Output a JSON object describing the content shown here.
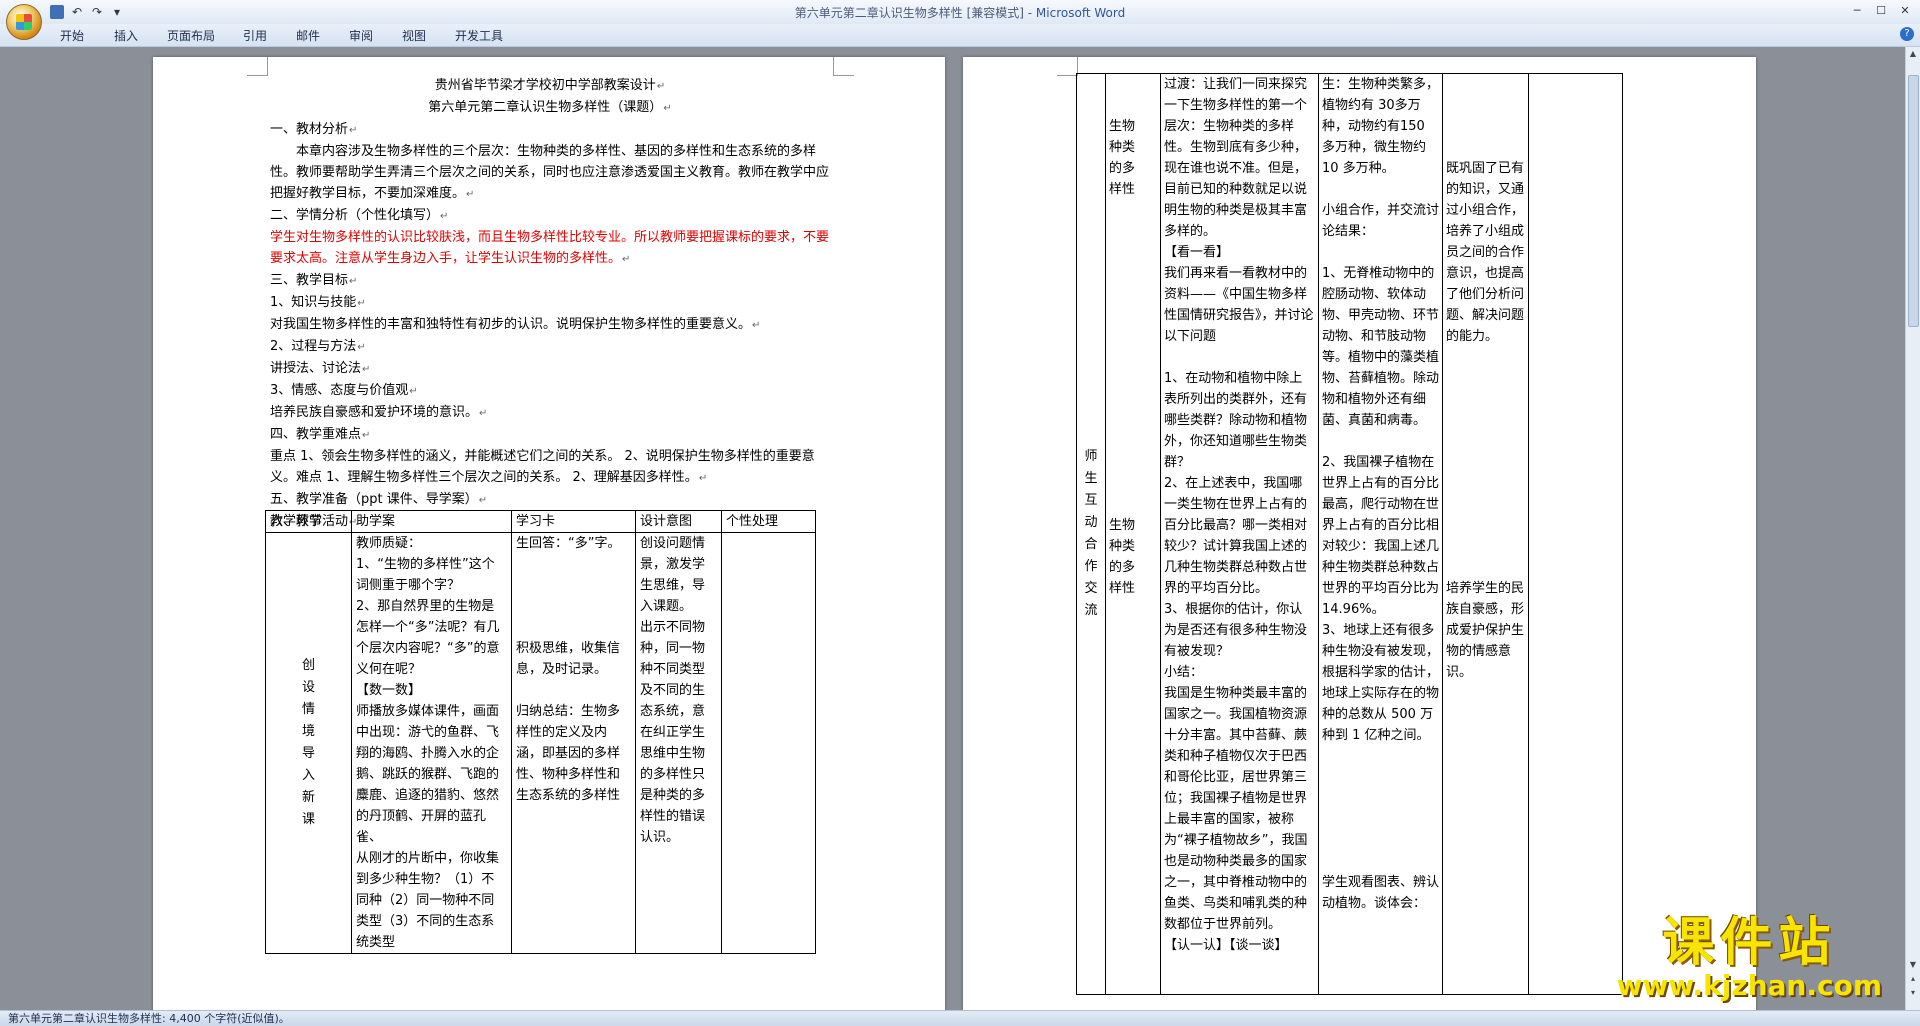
{
  "window": {
    "title": "第六单元第二章认识生物多样性 [兼容模式] - ",
    "app": "Microsoft Word"
  },
  "ribbon": {
    "tabs": [
      "开始",
      "插入",
      "页面布局",
      "引用",
      "邮件",
      "审阅",
      "视图",
      "开发工具"
    ]
  },
  "page1": {
    "title1": "贵州省毕节梁才学校初中学部教案设计",
    "title2": "第六单元第二章认识生物多样性（课题）",
    "lines": [
      {
        "text": "一、教材分析",
        "cls": ""
      },
      {
        "text": "本章内容涉及生物多样性的三个层次：生物种类的多样性、基因的多样性和生态系统的多样性。教师要帮助学生弄清三个层次之间的关系，同时也应注意渗透爱国主义教育。教师在教学中应把握好教学目标，不要加深难度。",
        "cls": "indent"
      },
      {
        "text": "二、学情分析（个性化填写）",
        "cls": ""
      },
      {
        "text": "学生对生物多样性的认识比较肤浅，而且生物多样性比较专业。所以教师要把握课标的要求，不要要求太高。注意从学生身边入手，让学生认识生物的多样性。",
        "cls": "red"
      },
      {
        "text": "三、教学目标",
        "cls": ""
      },
      {
        "text": "1、知识与技能",
        "cls": ""
      },
      {
        "text": "对我国生物多样性的丰富和独特性有初步的认识。说明保护生物多样性的重要意义。",
        "cls": ""
      },
      {
        "text": "2、过程与方法",
        "cls": ""
      },
      {
        "text": "讲授法、讨论法",
        "cls": ""
      },
      {
        "text": "3、情感、态度与价值观",
        "cls": ""
      },
      {
        "text": "培养民族自豪感和爱护环境的意识。",
        "cls": ""
      },
      {
        "text": "四、教学重难点",
        "cls": ""
      },
      {
        "text": "重点 1、领会生物多样性的涵义，并能概述它们之间的关系。   2、说明保护生物多样性的重要意义。难点 1、理解生物多样性三个层次之间的关系。   2、理解基因多样性。",
        "cls": ""
      },
      {
        "text": "五、教学准备（ppt 课件、导学案）",
        "cls": ""
      },
      {
        "text": "六、教学活动",
        "cls": ""
      }
    ],
    "table": {
      "headers": [
        "教学环节",
        "助学案",
        "学习卡",
        "设计意图",
        "个性处理"
      ],
      "stage": "创设情境导入新课",
      "assist": "教师质疑：\n1、“生物的多样性”这个词侧重于哪个字？\n2、那自然界里的生物是怎样一个“多”法呢？有几个层次内容呢？“多”的意义何在呢？\n【数一数】\n师播放多媒体课件，画面中出现：游弋的鱼群、飞翔的海鸥、扑腾入水的企鹅、跳跃的猴群、飞跑的麋鹿、追逐的猎豹、悠然的丹顶鹤、开屏的蓝孔雀、\n从刚才的片断中，你收集到多少种生物？（1）不同种（2）同一物种不同类型（3）不同的生态系统类型",
      "card": "生回答：“多”字。\n\n\n\n\n积极思维，收集信息，及时记录。\n\n归纳总结：生物多样性的定义及内涵，即基因的多样性、物种多样性和生态系统的多样性",
      "design": "创设问题情景，激发学生思维，导入课题。\n出示不同物种，同一物种不同类型及不同的生态系统，意在纠正学生思维中生物的多样性只是种类的多样性的错误认识。",
      "personal": ""
    }
  },
  "page2": {
    "stage": "师生互动合作交流",
    "sub1": "生物种类的多样性",
    "sub2": "生物种类的多样性",
    "assist": "过渡：让我们一同来探究一下生物多样性的第一个层次：生物种类的多样性。生物到底有多少种，现在谁也说不准。但是，目前已知的种数就足以说明生物的种类是极其丰富多样的。\n【看一看】\n我们再来看一看教材中的资料——《中国生物多样性国情研究报告》，并讨论以下问题\n\n1、在动物和植物中除上表所列出的类群外，还有哪些类群？除动物和植物外，你还知道哪些生物类群？\n2、在上述表中，我国哪一类生物在世界上占有的百分比最高？哪一类相对较少？试计算我国上述的几种生物类群总种数占世界的平均百分比。\n3、根据你的估计，你认为是否还有很多种生物没有被发现？\n小结：\n我国是生物种类最丰富的国家之一。我国植物资源十分丰富。其中苔藓、蕨类和种子植物仅次于巴西和哥伦比亚，居世界第三位；我国裸子植物是世界上最丰富的国家，被称为“裸子植物故乡”，我国也是动物种类最多的国家之一，其中脊椎动物中的鱼类、鸟类和哺乳类的种数都位于世界前列。\n【认一认】【谈一谈】",
    "card": "生：生物种类繁多，植物约有 30多万种，动物约有150 多万种，微生物约 10 多万种。\n\n小组合作，并交流讨论结果：\n\n1、无脊椎动物中的腔肠动物、软体动物、甲壳动物、环节动物、和节肢动物等。植物中的藻类植物、苔藓植物。除动物和植物外还有细菌、真菌和病毒。\n\n2、我国裸子植物在世界上占有的百分比最高，爬行动物在世界上占有的百分比相对较少：我国上述几种生物类群总种数占世界的平均百分比为 14.96%。\n3、地球上还有很多种生物没有被发现，根据科学家的估计，地球上实际存在的物种的总数从 500 万种到 1 亿种之间。\n\n\n\n\n\n\n学生观看图表、辨认动植物。谈体会：",
    "design": "\n\n\n\n既巩固了已有的知识，又通过小组合作，培养了小组成员之间的合作意识，也提高了他们分析问题、解决问题的能力。\n\n\n\n\n\n\n\n\n\n\n\n培养学生的民族自豪感，形成爱护保护生物的情感意识。",
    "personal": ""
  },
  "status": {
    "text": "第六单元第二章认识生物多样性: 4,400 个字符(近似值)。"
  },
  "watermark": {
    "line1": "课件站",
    "line2": "www.kjzhan.com"
  }
}
